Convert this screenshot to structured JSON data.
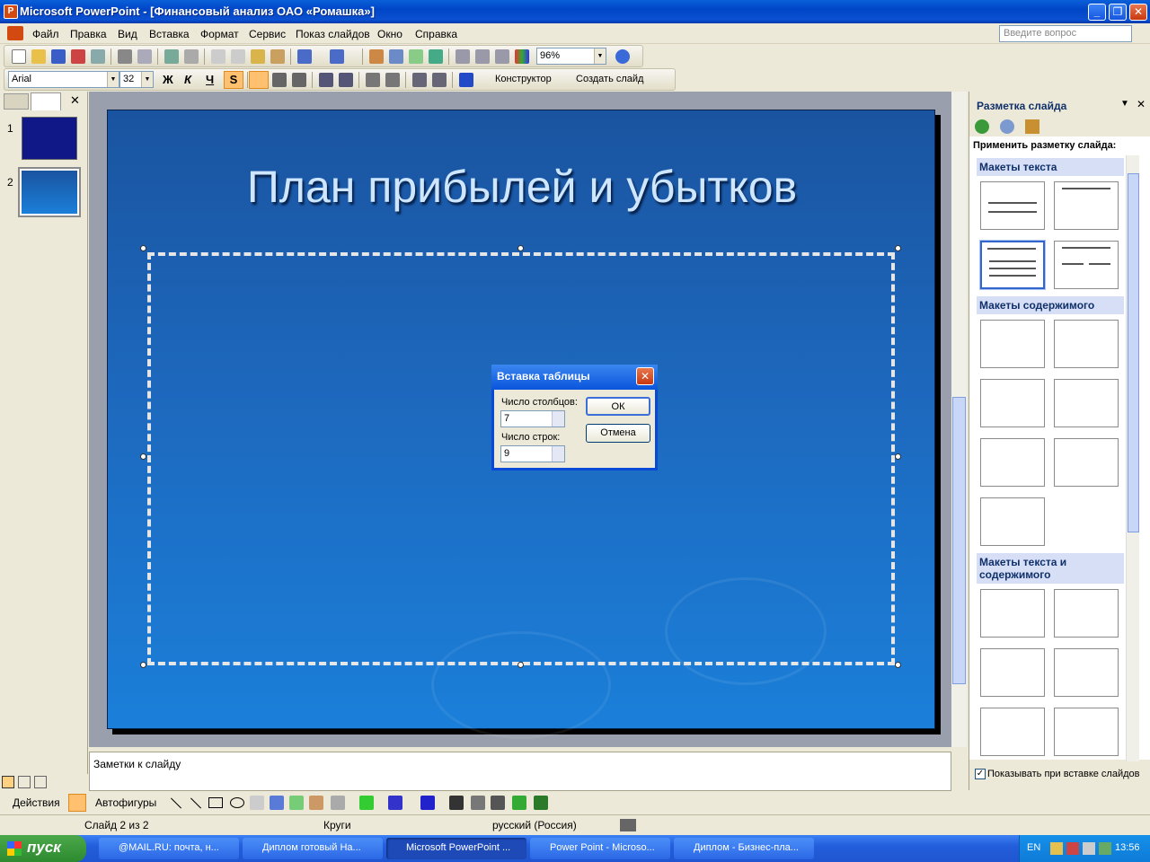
{
  "window": {
    "title": "Microsoft PowerPoint - [Финансовый анализ ОАО «Ромашка»]"
  },
  "menu": {
    "items": [
      "Файл",
      "Правка",
      "Вид",
      "Вставка",
      "Формат",
      "Сервис",
      "Показ слайдов",
      "Окно",
      "Справка"
    ],
    "help_placeholder": "Введите вопрос"
  },
  "standard_toolbar": {
    "zoom": "96%"
  },
  "format_toolbar": {
    "font": "Arial",
    "size": "32",
    "bold": "Ж",
    "italic": "К",
    "underline": "Ч",
    "shadow": "S",
    "designer": "Конструктор",
    "new_slide": "Создать слайд"
  },
  "thumbs": {
    "items": [
      {
        "num": "1"
      },
      {
        "num": "2"
      }
    ]
  },
  "slide": {
    "title": "План прибылей и убытков"
  },
  "notes": {
    "placeholder": "Заметки к слайду"
  },
  "dialog": {
    "title": "Вставка таблицы",
    "cols_label": "Число столбцов:",
    "cols_value": "7",
    "rows_label": "Число строк:",
    "rows_value": "9",
    "ok": "ОК",
    "cancel": "Отмена"
  },
  "taskpane": {
    "title": "Разметка слайда",
    "apply_label": "Применить разметку слайда:",
    "group_text": "Макеты текста",
    "group_content": "Макеты содержимого",
    "group_text_content": "Макеты текста и содержимого",
    "show_on_insert": "Показывать при вставке слайдов"
  },
  "drawbar": {
    "actions": "Действия",
    "autoshapes": "Автофигуры"
  },
  "status": {
    "slide": "Слайд 2 из 2",
    "design": "Круги",
    "lang": "русский (Россия)"
  },
  "taskbar": {
    "start": "пуск",
    "tasks": [
      "@MAIL.RU: почта, н...",
      "Диплом готовый На...",
      "Microsoft PowerPoint ...",
      "Power Point - Microso...",
      "Диплом - Бизнес-пла..."
    ],
    "lang": "EN",
    "clock": "13:56"
  },
  "colors": {
    "slide_bg": "#1d68bd",
    "title_bar": "#0a55dc",
    "task_pane_group": "#d6dff5"
  }
}
